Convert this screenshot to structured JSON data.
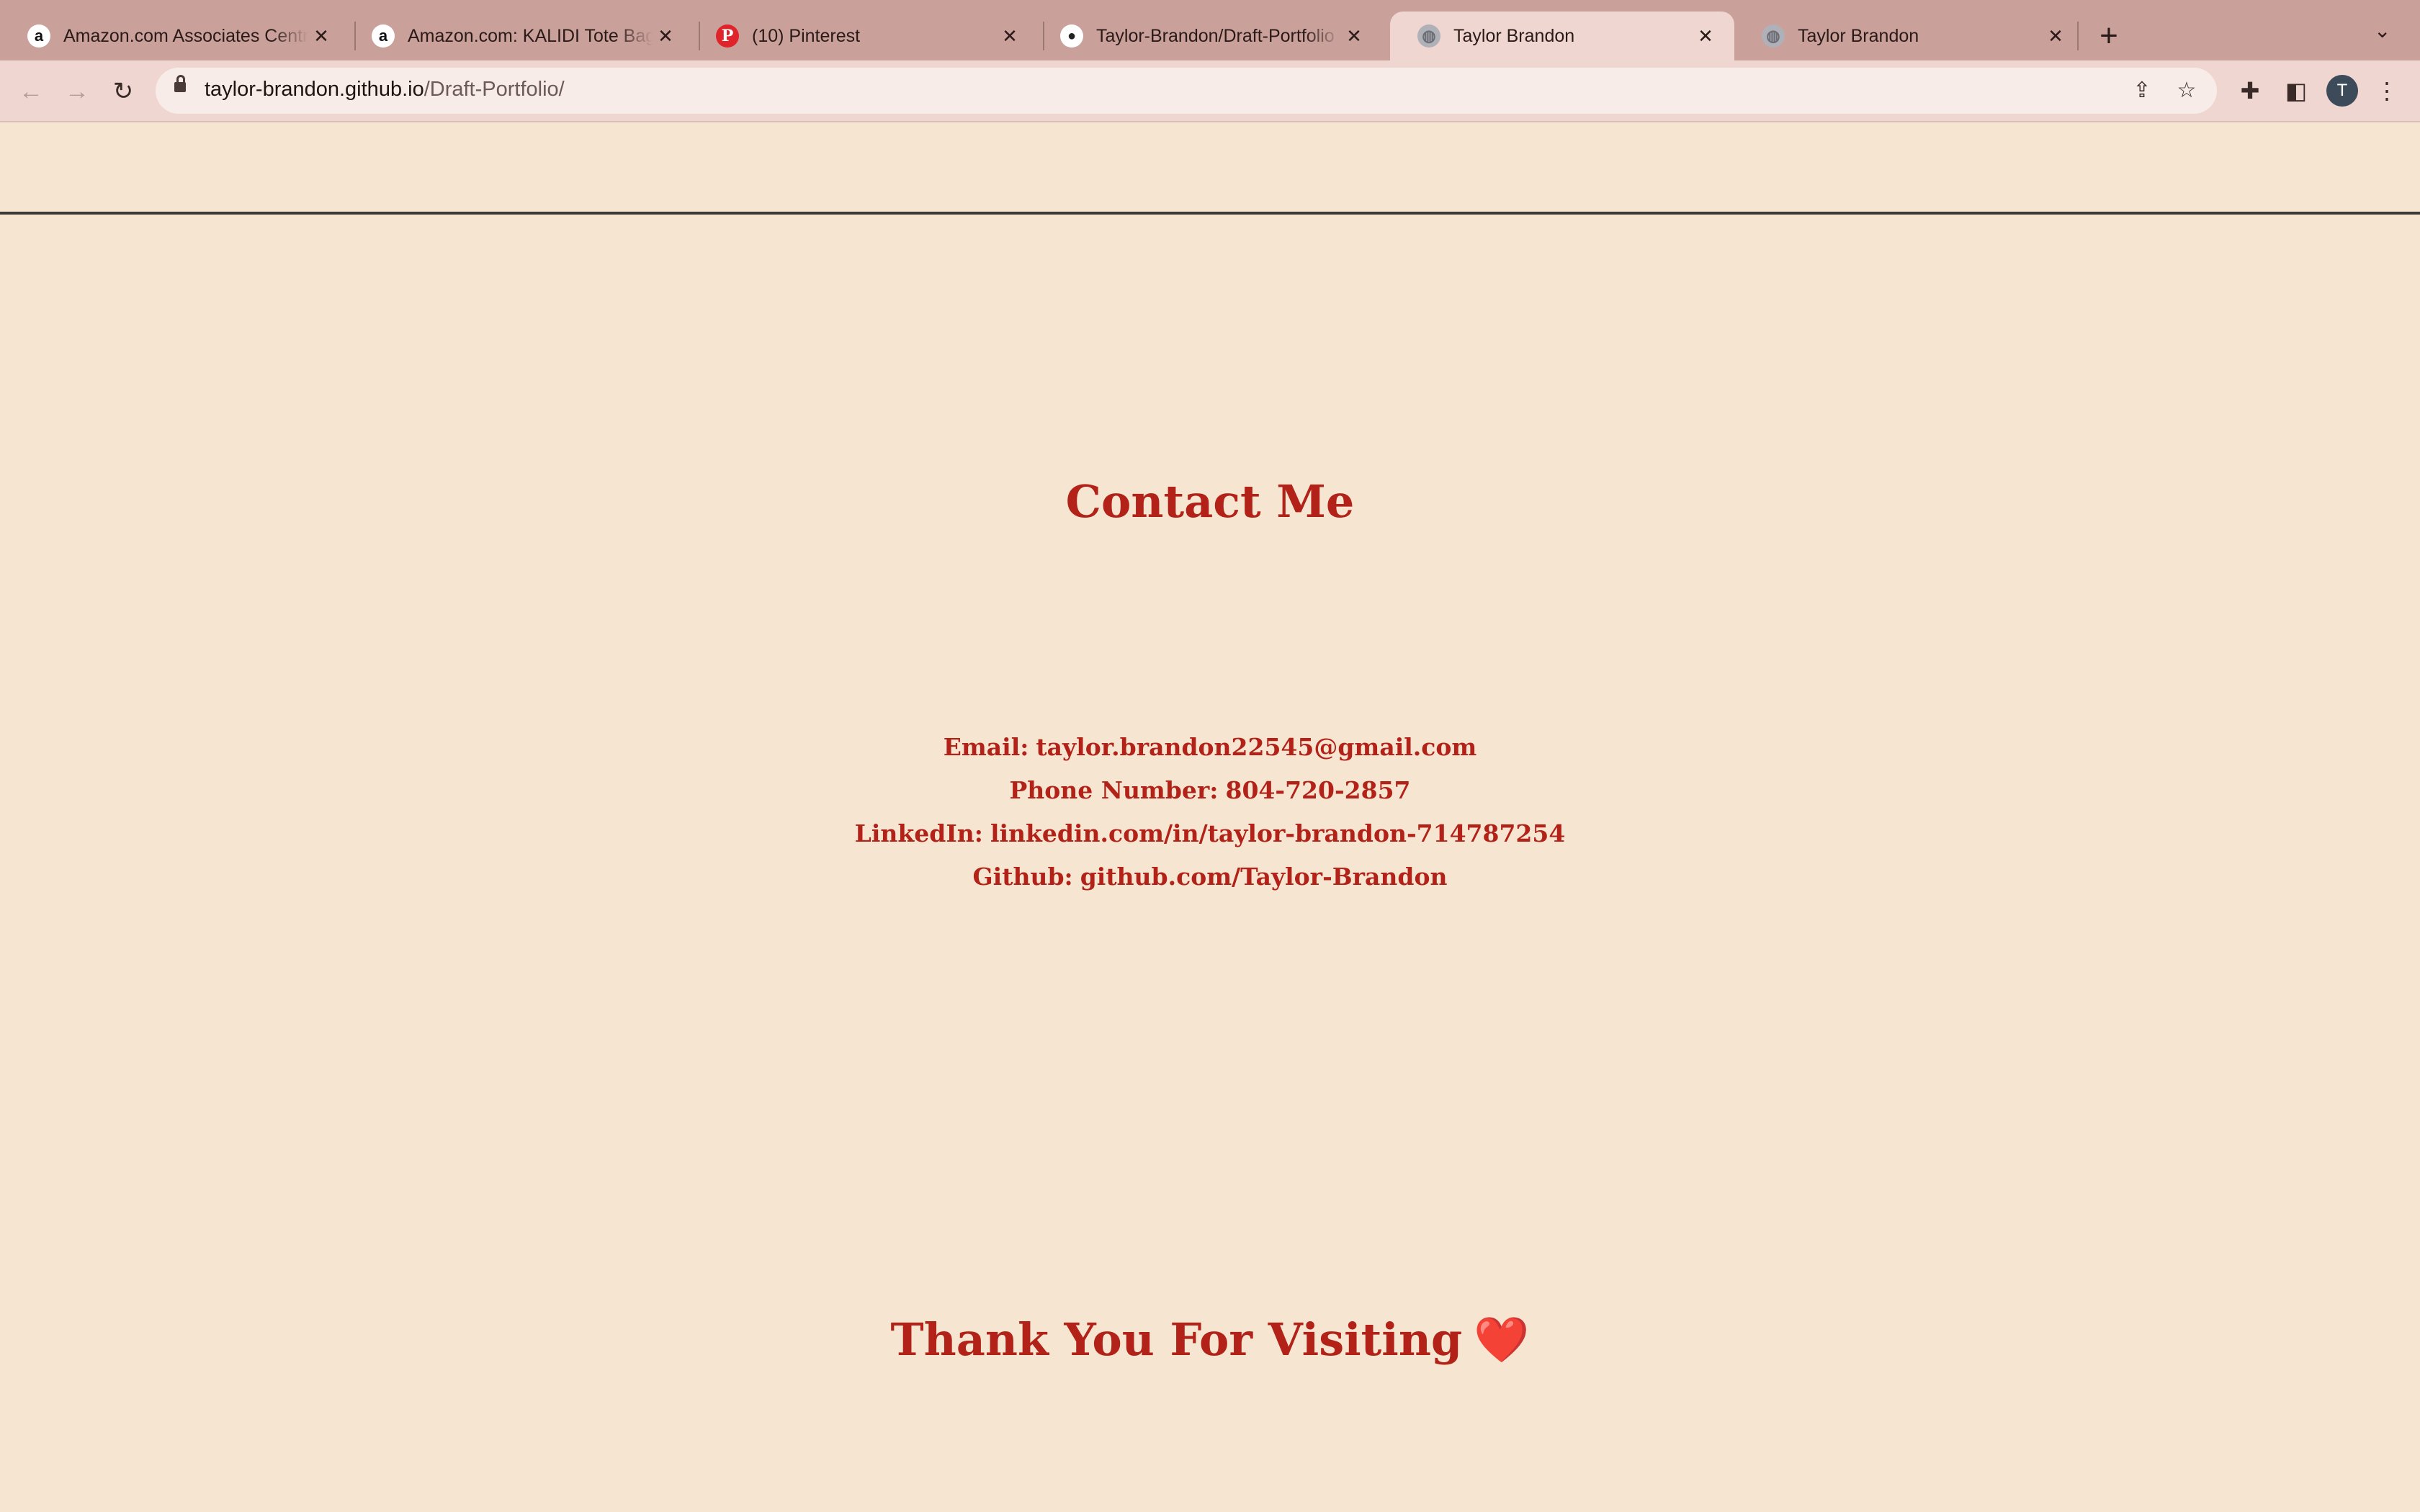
{
  "browser": {
    "tabs": [
      {
        "title": "Amazon.com Associates Central",
        "icon": "amazon-icon"
      },
      {
        "title": "Amazon.com: KALIDI Tote Bag",
        "icon": "amazon-icon"
      },
      {
        "title": "(10) Pinterest",
        "icon": "pinterest-icon"
      },
      {
        "title": "Taylor-Brandon/Draft-Portfolio",
        "icon": "github-icon"
      },
      {
        "title": "Taylor Brandon",
        "icon": "globe-icon",
        "active": true
      },
      {
        "title": "Taylor Brandon",
        "icon": "globe-icon"
      }
    ],
    "url_domain": "taylor-brandon.github.io",
    "url_path": "/Draft-Portfolio/",
    "profile_initial": "T"
  },
  "page": {
    "contact_heading": "Contact Me",
    "contacts": [
      {
        "label": "Email:",
        "value": "taylor.brandon22545@gmail.com"
      },
      {
        "label": "Phone Number:",
        "value": "804-720-2857"
      },
      {
        "label": "LinkedIn:",
        "value": "linkedin.com/in/taylor-brandon-714787254"
      },
      {
        "label": "Github:",
        "value": "github.com/Taylor-Brandon"
      }
    ],
    "thanks_heading": "Thank You For Visiting",
    "thanks_emoji": "❤️"
  },
  "colors": {
    "page_background": "#f6e6d1",
    "accent_text": "#b32218",
    "tab_strip": "#c9a09a",
    "toolbar": "#f0d6d0"
  }
}
